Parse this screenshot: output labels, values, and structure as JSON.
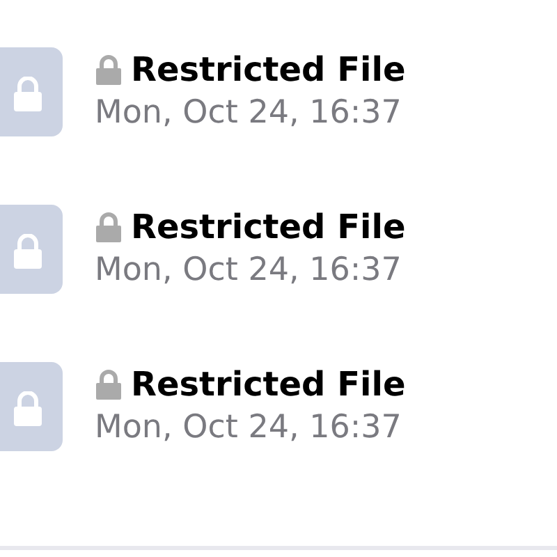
{
  "files": [
    {
      "title": "Restricted File",
      "date": "Mon, Oct 24, 16:37"
    },
    {
      "title": "Restricted File",
      "date": "Mon, Oct 24, 16:37"
    },
    {
      "title": "Restricted File",
      "date": "Mon, Oct 24, 16:37"
    }
  ]
}
